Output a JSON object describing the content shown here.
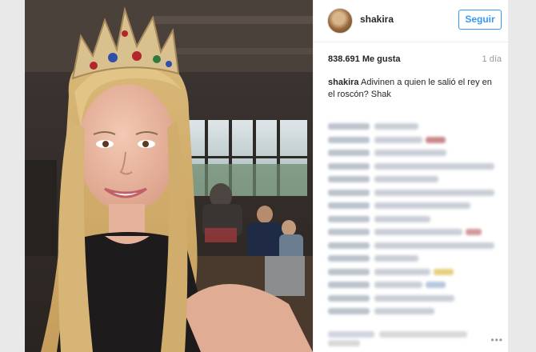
{
  "post": {
    "username": "shakira",
    "follow_label": "Seguir",
    "likes": "838.691 Me gusta",
    "time_ago": "1 día",
    "caption_user": "shakira",
    "caption_text": "Adivinen a quien le salió el rey en el roscón? Shak",
    "more_label": "•••"
  },
  "photo": {
    "subject": "woman with crown selfie",
    "crown_jewels": [
      "red",
      "blue",
      "green"
    ]
  },
  "comments_blurred": [
    {
      "w1": 55,
      "w2": 0,
      "c1": "#c9ced6",
      "c2": "#c9ced6"
    },
    {
      "w1": 60,
      "w2": 40,
      "c1": "#c9ced6",
      "c2": "#c9898c"
    },
    {
      "w1": 90,
      "w2": 0,
      "c1": "#c9ced6",
      "c2": "#c9ced6"
    },
    {
      "w1": 150,
      "w2": 0,
      "c1": "#c9ced6",
      "c2": "#c9ced6"
    },
    {
      "w1": 80,
      "w2": 0,
      "c1": "#c9ced6",
      "c2": "#9ec7d8"
    },
    {
      "w1": 190,
      "w2": 0,
      "c1": "#c9ced6",
      "c2": "#c9ced6"
    },
    {
      "w1": 120,
      "w2": 0,
      "c1": "#c9ced6",
      "c2": "#d8c97f"
    },
    {
      "w1": 70,
      "w2": 0,
      "c1": "#c9ced6",
      "c2": "#c9ced6"
    },
    {
      "w1": 110,
      "w2": 20,
      "c1": "#c9ced6",
      "c2": "#d49a9a"
    },
    {
      "w1": 200,
      "w2": 0,
      "c1": "#c9ced6",
      "c2": "#c9ced6"
    },
    {
      "w1": 55,
      "w2": 0,
      "c1": "#c9ced6",
      "c2": "#c9ced6"
    },
    {
      "w1": 70,
      "w2": 30,
      "c1": "#c9ced6",
      "c2": "#e6cf80"
    },
    {
      "w1": 60,
      "w2": 70,
      "c1": "#c9ced6",
      "c2": "#b8c7e0"
    },
    {
      "w1": 100,
      "w2": 0,
      "c1": "#c9ced6",
      "c2": "#c9ced6"
    },
    {
      "w1": 75,
      "w2": 0,
      "c1": "#c9ced6",
      "c2": "#c9ced6"
    }
  ],
  "colors": {
    "link": "#3897f0",
    "text": "#262626",
    "muted": "#999999"
  }
}
